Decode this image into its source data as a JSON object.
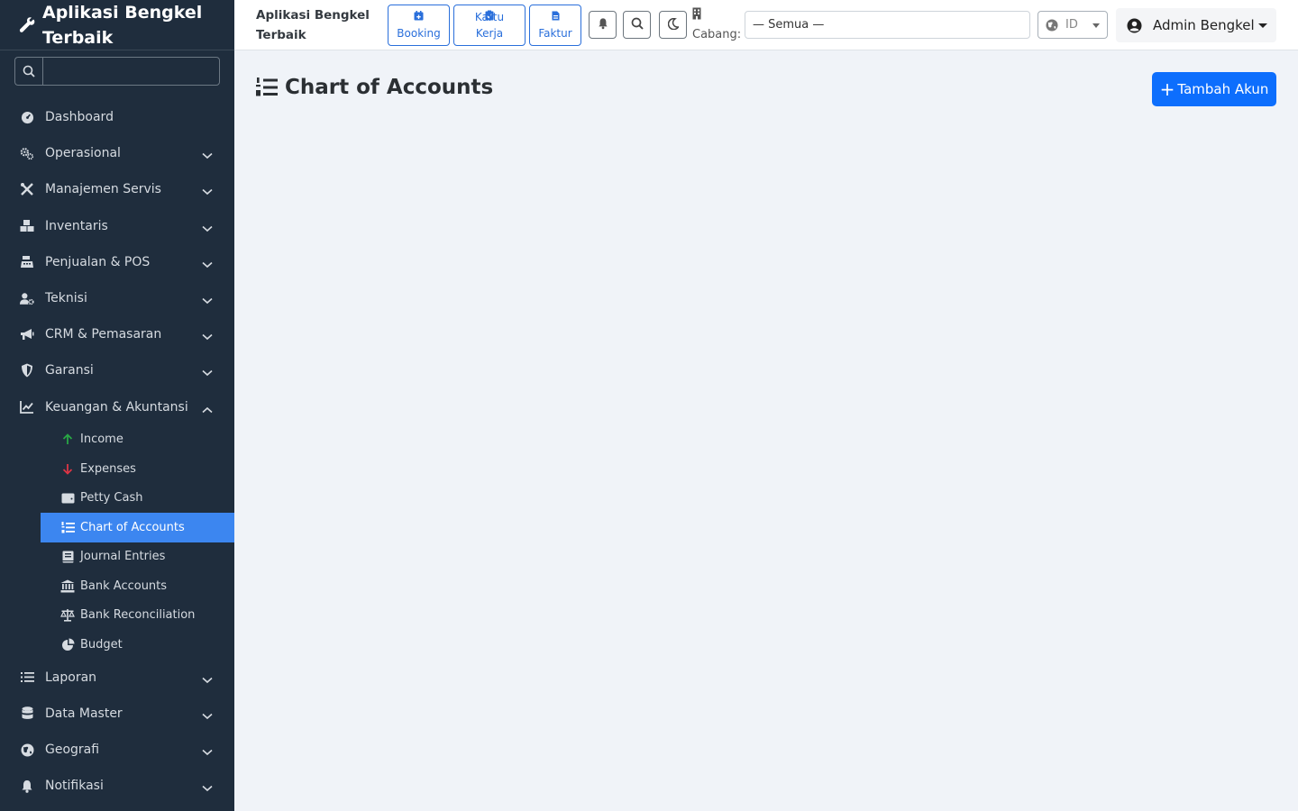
{
  "app": {
    "title": "Aplikasi Bengkel Terbaik"
  },
  "sidebar": {
    "search_placeholder": "",
    "items": [
      {
        "label": "Dashboard",
        "icon": "dashboard-icon"
      },
      {
        "label": "Operasional",
        "icon": "gears-icon"
      },
      {
        "label": "Manajemen Servis",
        "icon": "tools-icon"
      },
      {
        "label": "Inventaris",
        "icon": "boxes-icon"
      },
      {
        "label": "Penjualan & POS",
        "icon": "cash-register-icon"
      },
      {
        "label": "Teknisi",
        "icon": "user-gear-icon"
      },
      {
        "label": "CRM & Pemasaran",
        "icon": "bullhorn-icon"
      },
      {
        "label": "Garansi",
        "icon": "shield-icon"
      },
      {
        "label": "Keuangan & Akuntansi",
        "icon": "chart-line-icon"
      },
      {
        "label": "Laporan",
        "icon": "list-icon"
      },
      {
        "label": "Data Master",
        "icon": "database-icon"
      },
      {
        "label": "Geografi",
        "icon": "globe-icon"
      },
      {
        "label": "Notifikasi",
        "icon": "bell-icon"
      }
    ],
    "finance_sub": [
      {
        "label": "Income",
        "icon": "arrow-up-icon",
        "color": "#28a745"
      },
      {
        "label": "Expenses",
        "icon": "arrow-down-icon",
        "color": "#dc3545"
      },
      {
        "label": "Petty Cash",
        "icon": "wallet-icon"
      },
      {
        "label": "Chart of Accounts",
        "icon": "list-ol-icon",
        "active": true
      },
      {
        "label": "Journal Entries",
        "icon": "book-icon"
      },
      {
        "label": "Bank Accounts",
        "icon": "bank-icon"
      },
      {
        "label": "Bank Reconciliation",
        "icon": "scale-icon"
      },
      {
        "label": "Budget",
        "icon": "pie-chart-icon"
      }
    ]
  },
  "topbar": {
    "brand": "Aplikasi Bengkel Terbaik",
    "quick_buttons": [
      {
        "label": "Booking",
        "icon": "calendar-plus-icon"
      },
      {
        "label": "Kartu Kerja",
        "icon": "clipboard-check-icon"
      },
      {
        "label": "Faktur",
        "icon": "file-invoice-icon"
      }
    ],
    "cabang_label": "Cabang:",
    "cabang_value": "— Semua —",
    "language": "ID",
    "user_name": "Admin Bengkel"
  },
  "main": {
    "title": "Chart of Accounts",
    "add_button": "Tambah Akun"
  },
  "colors": {
    "sidebar_bg": "#1f2d3d",
    "active_item": "#3c86f0",
    "primary": "#0d6efd",
    "page_bg": "#f0f3f8"
  }
}
